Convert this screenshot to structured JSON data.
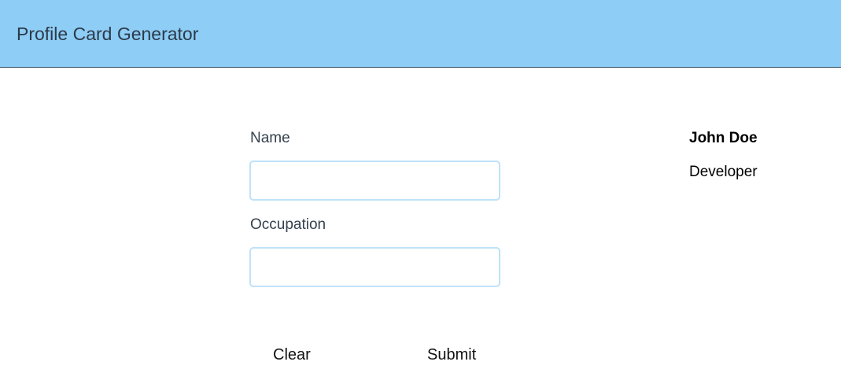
{
  "header": {
    "title": "Profile Card Generator",
    "background_color": "#8ecdf5"
  },
  "form": {
    "name_label": "Name",
    "name_value": "",
    "name_placeholder": "",
    "occupation_label": "Occupation",
    "occupation_value": "",
    "occupation_placeholder": "",
    "input_border_color": "#bfe2f8"
  },
  "actions": {
    "clear_label": "Clear",
    "submit_label": "Submit"
  },
  "card": {
    "name": "John Doe",
    "occupation": "Developer"
  }
}
